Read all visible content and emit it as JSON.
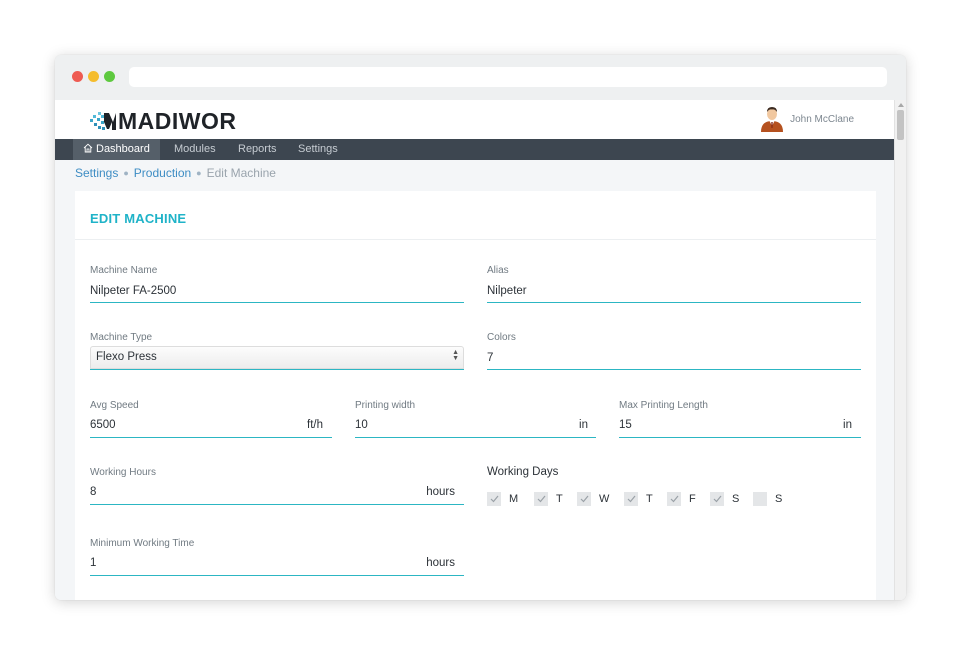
{
  "app": {
    "brand": "MADIWOR",
    "user_name": "John McClane"
  },
  "nav": {
    "items": [
      {
        "label": "Dashboard",
        "icon": "home-icon",
        "active": true
      },
      {
        "label": "Modules",
        "active": false
      },
      {
        "label": "Reports",
        "active": false
      },
      {
        "label": "Settings",
        "active": false
      }
    ]
  },
  "breadcrumb": {
    "items": [
      "Settings",
      "Production"
    ],
    "current": "Edit Machine"
  },
  "form": {
    "title": "EDIT MACHINE",
    "machine_name": {
      "label": "Machine Name",
      "value": "Nilpeter FA-2500"
    },
    "alias": {
      "label": "Alias",
      "value": "Nilpeter"
    },
    "machine_type": {
      "label": "Machine Type",
      "value": "Flexo Press"
    },
    "colors": {
      "label": "Colors",
      "value": "7"
    },
    "avg_speed": {
      "label": "Avg Speed",
      "value": "6500",
      "unit": "ft/h"
    },
    "printing_width": {
      "label": "Printing width",
      "value": "10",
      "unit": "in"
    },
    "max_printing_length": {
      "label": "Max Printing Length",
      "value": "15",
      "unit": "in"
    },
    "working_hours": {
      "label": "Working Hours",
      "value": "8",
      "unit": "hours"
    },
    "working_days": {
      "label": "Working Days",
      "days": [
        {
          "label": "M",
          "checked": true
        },
        {
          "label": "T",
          "checked": true
        },
        {
          "label": "W",
          "checked": true
        },
        {
          "label": "T",
          "checked": true
        },
        {
          "label": "F",
          "checked": true
        },
        {
          "label": "S",
          "checked": true
        },
        {
          "label": "S",
          "checked": false
        }
      ]
    },
    "min_working_time": {
      "label": "Minimum Working Time",
      "value": "1",
      "unit": "hours"
    }
  },
  "colors": {
    "accent": "#2cb6c3",
    "title_accent": "#1fb3c8",
    "nav_bg": "#3d4650",
    "link": "#3e8dc4"
  }
}
